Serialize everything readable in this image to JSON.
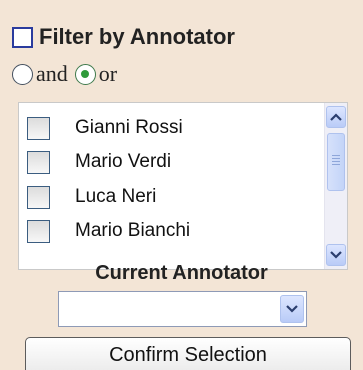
{
  "filter": {
    "title": "Filter by Annotator",
    "checked": false
  },
  "logic": {
    "options": [
      "and",
      "or"
    ],
    "selected": "or"
  },
  "annotators": {
    "items": [
      {
        "label": "Gianni Rossi",
        "checked": false
      },
      {
        "label": "Mario Verdi",
        "checked": false
      },
      {
        "label": "Luca Neri",
        "checked": false
      },
      {
        "label": "Mario Bianchi",
        "checked": false
      }
    ]
  },
  "current": {
    "label": "Current Annotator",
    "value": ""
  },
  "confirm": {
    "label": "Confirm Selection"
  },
  "icons": {
    "scroll_up": "chevron-up-icon",
    "scroll_down": "chevron-down-icon",
    "select_arrow": "chevron-down-icon"
  },
  "colors": {
    "panel_bg": "#F3E5D6",
    "radio_selected": "#2F9A3A",
    "scrollbar_accent": "#B9CBF7"
  }
}
